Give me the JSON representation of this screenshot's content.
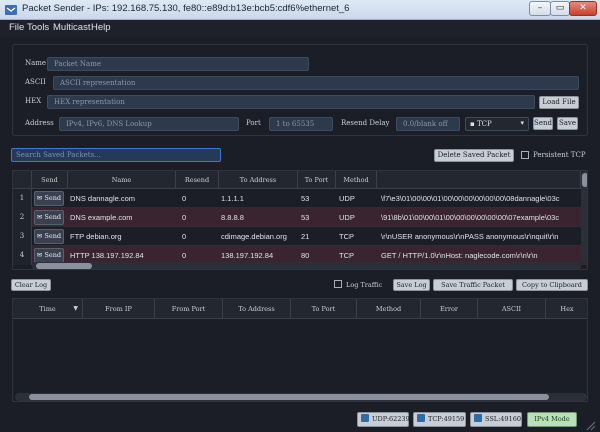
{
  "window": {
    "title": "Packet Sender - IPs: 192.168.75.130, fe80::e89d:b13e:bcb5:cdf6%ethernet_6",
    "min": "–",
    "max": "▭",
    "close": "✕"
  },
  "menu": [
    "File",
    "Tools",
    "Multicast",
    "Help"
  ],
  "editor": {
    "name_label": "Name",
    "name_placeholder": "Packet Name",
    "ascii_label": "ASCII",
    "ascii_placeholder": "ASCII representation",
    "hex_label": "HEX",
    "hex_placeholder": "HEX representation",
    "load_file": "Load File",
    "address_label": "Address",
    "address_placeholder": "IPv4, IPv6, DNS Lookup",
    "port_label": "Port",
    "port_placeholder": "1 to 65535",
    "resend_label": "Resend Delay",
    "resend_placeholder": "0.0/blank off",
    "protocol": "TCP",
    "send": "Send",
    "save": "Save"
  },
  "search": {
    "placeholder": "Search Saved Packets...",
    "delete_button": "Delete Saved Packet",
    "persistent_label": "Persistent TCP"
  },
  "saved_table": {
    "headers": [
      "Send",
      "Name",
      "Resend",
      "To Address",
      "To Port",
      "Method",
      ""
    ],
    "send_label": "Send",
    "rows": [
      {
        "num": "1",
        "name": "DNS dannagle.com",
        "resend": "0",
        "to_address": "1.1.1.1",
        "to_port": "53",
        "method": "UDP",
        "data": "\\f7\\e3\\01\\00\\00\\01\\00\\00\\00\\00\\00\\00\\08dannagle\\03c"
      },
      {
        "num": "2",
        "name": "DNS example.com",
        "resend": "0",
        "to_address": "8.8.8.8",
        "to_port": "53",
        "method": "UDP",
        "data": "\\91\\8b\\01\\00\\00\\01\\00\\00\\00\\00\\00\\00\\07example\\03c"
      },
      {
        "num": "3",
        "name": "FTP debian.org",
        "resend": "0",
        "to_address": "cdimage.debian.org",
        "to_port": "21",
        "method": "TCP",
        "data": "\\r\\nUSER anonymous\\r\\nPASS anonymous\\r\\nquit\\r\\n"
      },
      {
        "num": "4",
        "name": "HTTP 138.197.192.84",
        "resend": "0",
        "to_address": "138.197.192.84",
        "to_port": "80",
        "method": "TCP",
        "data": "GET / HTTP/1.0\\r\\nHost: naglecode.com\\r\\n\\r\\n"
      }
    ]
  },
  "log_toolbar": {
    "clear_log": "Clear Log",
    "log_traffic": "Log Traffic",
    "save_log": "Save Log",
    "save_traffic_packet": "Save Traffic Packet",
    "copy_clipboard": "Copy to Clipboard"
  },
  "log_table": {
    "headers": [
      "Time",
      "From IP",
      "From Port",
      "To Address",
      "To Port",
      "Method",
      "Error",
      "ASCII",
      "Hex"
    ]
  },
  "status": {
    "udp": "UDP:62239",
    "tcp": "TCP:49159",
    "ssl": "SSL:49160",
    "mode": "IPv4 Mode"
  },
  "colors": {
    "background": "#1b1e26",
    "field": "#2c3a4c",
    "search_focus": "#3a7bd5",
    "row_highlight": "#3a2430",
    "ipv4_mode": "#b9e0b6"
  }
}
